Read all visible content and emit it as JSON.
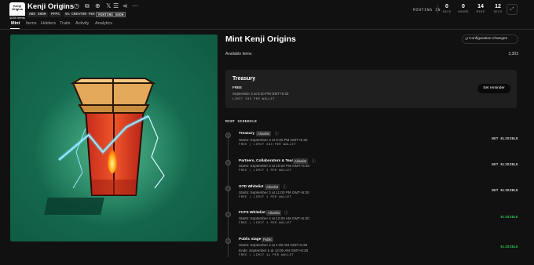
{
  "collection": {
    "logo_text": "Kenji Origins",
    "logo_subtext": "1000 items",
    "name": "Kenji Origins",
    "badges": [
      "ABS 3NDR",
      "PFPS",
      "5% CREATOR FEE",
      "MINTING SOON"
    ]
  },
  "header_icons": [
    "star-icon",
    "clock-icon",
    "copy-icon",
    "globe-icon",
    "x-twitter-icon",
    "menu-icon",
    "share-icon",
    "more-icon"
  ],
  "countdown": {
    "label": "MINTING IN",
    "units": [
      {
        "value": "0",
        "label": "DAYS"
      },
      {
        "value": "0",
        "label": "HOURS"
      },
      {
        "value": "14",
        "label": "MINS"
      },
      {
        "value": "12",
        "label": "SECS"
      }
    ]
  },
  "tabs": [
    "Mint",
    "Items",
    "Holders",
    "Traits",
    "Activity",
    "Analytics"
  ],
  "active_tab": "Mint",
  "mint": {
    "title": "Mint Kenji Origins",
    "config_button": "Configuration Changes",
    "available_label": "Available items",
    "available_value": "3,303"
  },
  "featured_stage": {
    "name": "Treasury",
    "price": "FREE",
    "date": "September 3 at 9:30 PM GMT+5:30",
    "limit": "LIMIT 333 PER WALLET",
    "button": "Set reminder"
  },
  "schedule": {
    "title": "MINT SCHEDULE",
    "stages": [
      {
        "name": "Treasury",
        "tag": "Allowlist",
        "lines": [
          "Starts: September 3 at 9:30 PM GMT+5:30"
        ],
        "limit": "FREE | LIMIT 333 PER WALLET",
        "status": "NOT ELIGIBLE",
        "eligible": false
      },
      {
        "name": "Partners, Collaborators & Team",
        "tag": "Allowlist",
        "lines": [
          "Starts: September 3 at 10:00 PM GMT+5:30"
        ],
        "limit": "FREE | LIMIT 1 PER WALLET",
        "status": "NOT ELIGIBLE",
        "eligible": false
      },
      {
        "name": "GTD Whitelist",
        "tag": "Allowlist",
        "lines": [
          "Starts: September 3 at 11:00 PM GMT+5:30"
        ],
        "limit": "FREE | LIMIT 1 PER WALLET",
        "status": "NOT ELIGIBLE",
        "eligible": false
      },
      {
        "name": "FCFS Whitelist",
        "tag": "Allowlist",
        "lines": [
          "Starts: September 4 at 12:00 AM GMT+5:30"
        ],
        "limit": "FREE | LIMIT 1 PER WALLET",
        "status": "ELIGIBLE",
        "eligible": true
      },
      {
        "name": "Public stage",
        "tag": "Public",
        "lines": [
          "Starts: September 4 at 1:00 AM GMT+5:30",
          "Ends: September 5 at 12:00 AM GMT+5:30"
        ],
        "limit": "FREE | LIMIT 11 PER WALLET",
        "status": "ELIGIBLE",
        "eligible": true
      }
    ]
  },
  "colors": {
    "background": "#111111",
    "artwork_bg": "#156b50",
    "card": "#1f1f1f",
    "eligible": "#34c759"
  }
}
